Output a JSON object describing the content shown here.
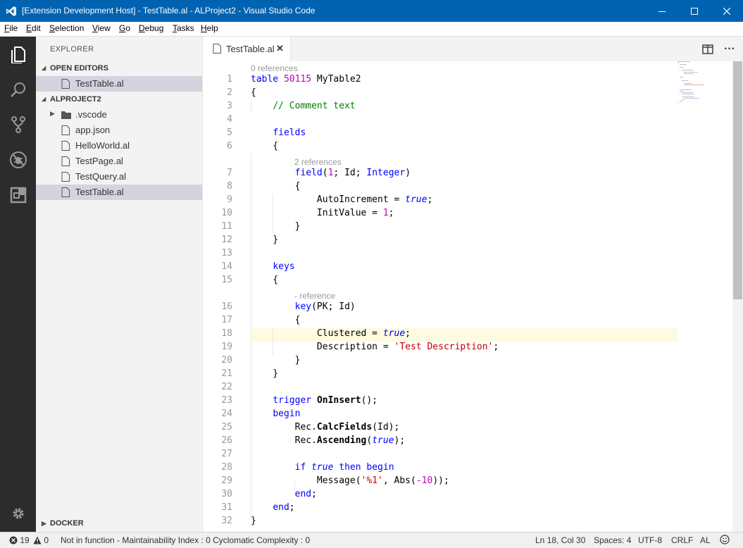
{
  "window": {
    "title": "[Extension Development Host] - TestTable.al - ALProject2 - Visual Studio Code",
    "app_icon": "vscode-icon",
    "controls": [
      "minimize-icon",
      "maximize-icon",
      "close-icon"
    ]
  },
  "menu": {
    "items": [
      "File",
      "Edit",
      "Selection",
      "View",
      "Go",
      "Debug",
      "Tasks",
      "Help"
    ]
  },
  "activity_bar": {
    "items": [
      "explorer-icon",
      "search-icon",
      "source-control-icon",
      "debug-icon",
      "extensions-icon"
    ],
    "bottom": "gear-icon"
  },
  "sidebar": {
    "title": "EXPLORER",
    "open_editors": {
      "label": "OPEN EDITORS",
      "files": [
        "TestTable.al"
      ]
    },
    "project": {
      "label": "ALPROJECT2",
      "items": [
        ".vscode",
        "app.json",
        "HelloWorld.al",
        "TestPage.al",
        "TestQuery.al",
        "TestTable.al"
      ]
    },
    "docker": "DOCKER"
  },
  "tabs": [
    {
      "label": "TestTable.al",
      "close": "✕"
    }
  ],
  "editor": {
    "active_line": 18,
    "lenses": {
      "l1": "0 references",
      "l7": "2 references",
      "l16": "- reference"
    },
    "line_numbers": [
      "1",
      "2",
      "3",
      "4",
      "5",
      "6",
      "7",
      "8",
      "9",
      "10",
      "11",
      "12",
      "13",
      "14",
      "15",
      "16",
      "17",
      "18",
      "19",
      "20",
      "21",
      "22",
      "23",
      "24",
      "25",
      "26",
      "27",
      "28",
      "29",
      "30",
      "31",
      "32"
    ]
  },
  "status_bar": {
    "errors": "19",
    "warnings": "0",
    "message": "Not in function - Maintainability Index : 0 Cyclomatic Complexity : 0",
    "position": "Ln 18, Col 30",
    "spaces": "Spaces: 4",
    "encoding": "UTF-8",
    "eol": "CRLF",
    "language": "AL",
    "feedback": "smiley-icon"
  },
  "colors": {
    "titlebar": "#0063b1",
    "activitybar": "#2c2c2c",
    "sidebar": "#f3f3f3",
    "keyword": "#0000ff",
    "number": "#c000c0",
    "comment": "#008000",
    "string": "#c00000"
  }
}
